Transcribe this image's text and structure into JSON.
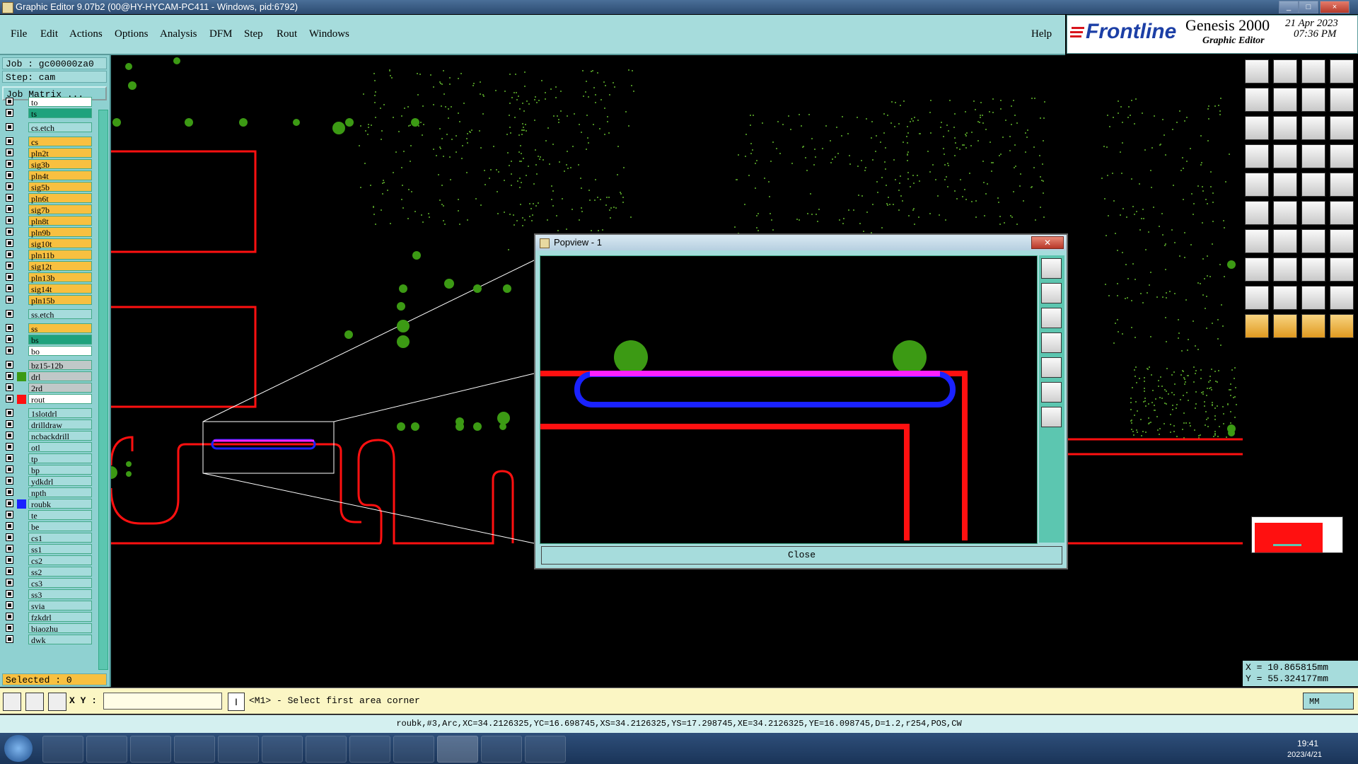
{
  "window": {
    "title": "Graphic Editor 9.07b2 (00@HY-HYCAM-PC411 - Windows, pid:6792)",
    "controls": [
      "_",
      "□",
      "×"
    ]
  },
  "menu": {
    "items": [
      "File",
      "Edit",
      "Actions",
      "Options",
      "Analysis",
      "DFM",
      "Step",
      "Rout",
      "Windows"
    ],
    "help": "Help"
  },
  "brand": {
    "logo": "Frontline",
    "product": "Genesis 2000",
    "subtitle": "Graphic Editor",
    "date": "21 Apr 2023",
    "time": "07:36 PM"
  },
  "job": {
    "job_label": "Job : gc00000za0",
    "step_label": "Step: cam",
    "matrix_button": "Job Matrix ..."
  },
  "layers": [
    {
      "name": "to",
      "color": "#ffffff"
    },
    {
      "name": "ts",
      "color": "#1fa27d"
    },
    {
      "name": "cs.etch",
      "color": "#a6dcdc"
    },
    {
      "name": "cs",
      "color": "#f8c040"
    },
    {
      "name": "pln2t",
      "color": "#f8c040"
    },
    {
      "name": "sig3b",
      "color": "#f8c040"
    },
    {
      "name": "pln4t",
      "color": "#f8c040"
    },
    {
      "name": "sig5b",
      "color": "#f8c040"
    },
    {
      "name": "pln6t",
      "color": "#f8c040"
    },
    {
      "name": "sig7b",
      "color": "#f8c040"
    },
    {
      "name": "pln8t",
      "color": "#f8c040"
    },
    {
      "name": "pln9b",
      "color": "#f8c040"
    },
    {
      "name": "sig10t",
      "color": "#f8c040"
    },
    {
      "name": "pln11b",
      "color": "#f8c040"
    },
    {
      "name": "sig12t",
      "color": "#f8c040"
    },
    {
      "name": "pln13b",
      "color": "#f8c040"
    },
    {
      "name": "sig14t",
      "color": "#f8c040"
    },
    {
      "name": "pln15b",
      "color": "#f8c040"
    },
    {
      "name": "ss.etch",
      "color": "#a6dcdc"
    },
    {
      "name": "ss",
      "color": "#f8c040"
    },
    {
      "name": "bs",
      "color": "#1fa27d"
    },
    {
      "name": "bo",
      "color": "#ffffff"
    },
    {
      "name": "bz15-12b",
      "color": "#c0c8c8"
    },
    {
      "name": "drl",
      "color": "#c0c8c8"
    },
    {
      "name": "2rd",
      "color": "#c0c8c8"
    },
    {
      "name": "rout",
      "color": "#ffffff"
    },
    {
      "name": "1slotdrl",
      "color": "#a6dcdc"
    },
    {
      "name": "drilldraw",
      "color": "#a6dcdc"
    },
    {
      "name": "ncbackdrill",
      "color": "#a6dcdc"
    },
    {
      "name": "otl",
      "color": "#a6dcdc"
    },
    {
      "name": "tp",
      "color": "#a6dcdc"
    },
    {
      "name": "bp",
      "color": "#a6dcdc"
    },
    {
      "name": "ydkdrl",
      "color": "#a6dcdc"
    },
    {
      "name": "npth",
      "color": "#a6dcdc"
    },
    {
      "name": "roubk",
      "color": "#a6dcdc"
    },
    {
      "name": "te",
      "color": "#a6dcdc"
    },
    {
      "name": "be",
      "color": "#a6dcdc"
    },
    {
      "name": "cs1",
      "color": "#a6dcdc"
    },
    {
      "name": "ss1",
      "color": "#a6dcdc"
    },
    {
      "name": "cs2",
      "color": "#a6dcdc"
    },
    {
      "name": "ss2",
      "color": "#a6dcdc"
    },
    {
      "name": "cs3",
      "color": "#a6dcdc"
    },
    {
      "name": "ss3",
      "color": "#a6dcdc"
    },
    {
      "name": "svia",
      "color": "#a6dcdc"
    },
    {
      "name": "fzkdrl",
      "color": "#a6dcdc"
    },
    {
      "name": "biaozhu",
      "color": "#a6dcdc"
    },
    {
      "name": "dwk",
      "color": "#a6dcdc"
    }
  ],
  "selected_label": "Selected : 0",
  "popview": {
    "title": "Popview - 1",
    "close_button": "Close"
  },
  "coords": {
    "x": "X = 10.865815mm",
    "y": "Y = 55.324177mm"
  },
  "command": {
    "xy_label": "X Y :",
    "xy_value": "",
    "prompt": "<M1> - Select first area corner",
    "units": "MM"
  },
  "status": "roubk,#3,Arc,XC=34.2126325,YC=16.698745,XS=34.2126325,YS=17.298745,XE=34.2126325,YE=16.098745,D=1.2,r254,POS,CW",
  "clock": {
    "time": "19:41",
    "date": "2023/4/21"
  },
  "colors": {
    "red": "#ff1010",
    "green": "#3c9a14",
    "blue": "#1a22ff",
    "magenta": "#ff20ff",
    "panel": "#a6dcdc"
  }
}
